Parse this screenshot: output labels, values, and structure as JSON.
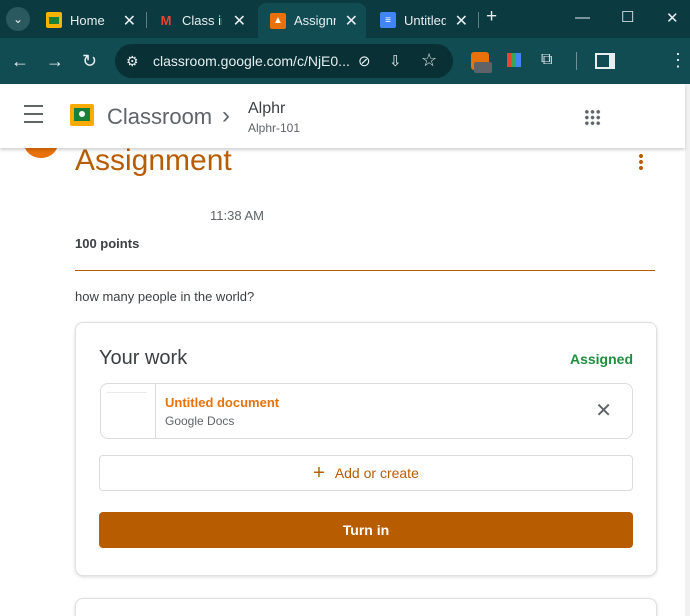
{
  "browser": {
    "tabs": [
      {
        "label": "Home",
        "icon": "classroom-icon"
      },
      {
        "label": "Class in",
        "icon": "gmail-icon"
      },
      {
        "label": "Assignm",
        "icon": "classroom-icon",
        "active": true
      },
      {
        "label": "Untitled",
        "icon": "docs-icon"
      }
    ],
    "url": "classroom.google.com/c/NjE0..."
  },
  "appbar": {
    "brand": "Classroom",
    "breadcrumb_arrow": "›",
    "class_name": "Alphr",
    "class_section": "Alphr-101"
  },
  "assignment": {
    "title": "Assignment",
    "time": "11:38 AM",
    "points": "100 points",
    "description": "how many people in the world?"
  },
  "your_work": {
    "heading": "Your work",
    "status": "Assigned",
    "attachment": {
      "title": "Untitled document",
      "subtitle": "Google Docs"
    },
    "add_label": "Add or create",
    "add_plus": "+",
    "turn_in_label": "Turn in"
  },
  "colors": {
    "accent": "#b85c00",
    "assigned_green": "#1e8e3e",
    "tab_bar": "#0b3a40",
    "toolbar": "#114c53"
  }
}
